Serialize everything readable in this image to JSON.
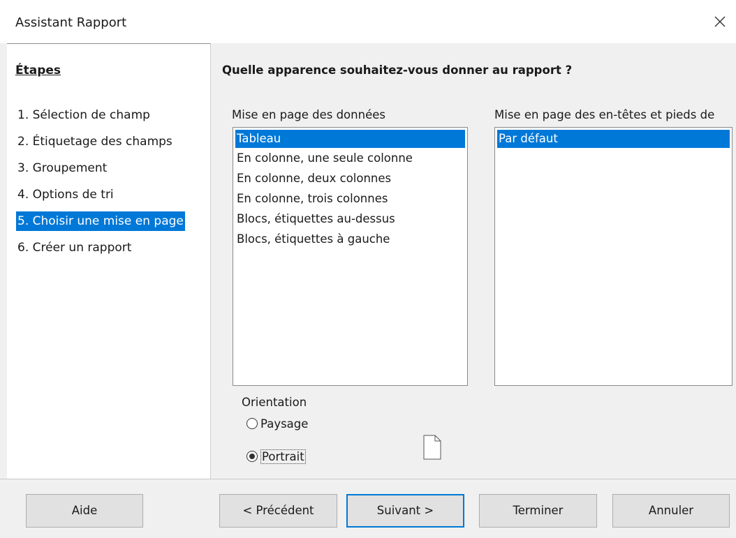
{
  "window": {
    "title": "Assistant Rapport",
    "close_icon": "close-icon"
  },
  "steps": {
    "heading": "Étapes",
    "items": [
      {
        "label": "1. Sélection de champ",
        "active": false
      },
      {
        "label": "2. Étiquetage des champs",
        "active": false
      },
      {
        "label": "3. Groupement",
        "active": false
      },
      {
        "label": "4. Options de tri",
        "active": false
      },
      {
        "label": "5. Choisir une mise en page",
        "active": true
      },
      {
        "label": "6. Créer un rapport",
        "active": false
      }
    ]
  },
  "main": {
    "question": "Quelle apparence souhaitez-vous donner au rapport ?",
    "data_layout": {
      "label": "Mise en page des données",
      "options": [
        "Tableau",
        "En colonne, une seule colonne",
        "En colonne, deux colonnes",
        "En colonne, trois colonnes",
        "Blocs, étiquettes au-dessus",
        "Blocs, étiquettes à gauche"
      ],
      "selected": "Tableau"
    },
    "header_layout": {
      "label": "Mise en page des en-têtes et pieds de",
      "options": [
        "Par défaut"
      ],
      "selected": "Par défaut"
    },
    "orientation": {
      "label": "Orientation",
      "options": [
        {
          "label": "Paysage",
          "checked": false
        },
        {
          "label": "Portrait",
          "checked": true
        }
      ],
      "preview_icon": "page-portrait-icon"
    }
  },
  "footer": {
    "help": "Aide",
    "previous": "< Précédent",
    "next": "Suivant >",
    "finish": "Terminer",
    "cancel": "Annuler"
  },
  "colors": {
    "selection": "#0078d7",
    "dialog_bg": "#f0f0f0",
    "button_bg": "#e1e1e1"
  }
}
